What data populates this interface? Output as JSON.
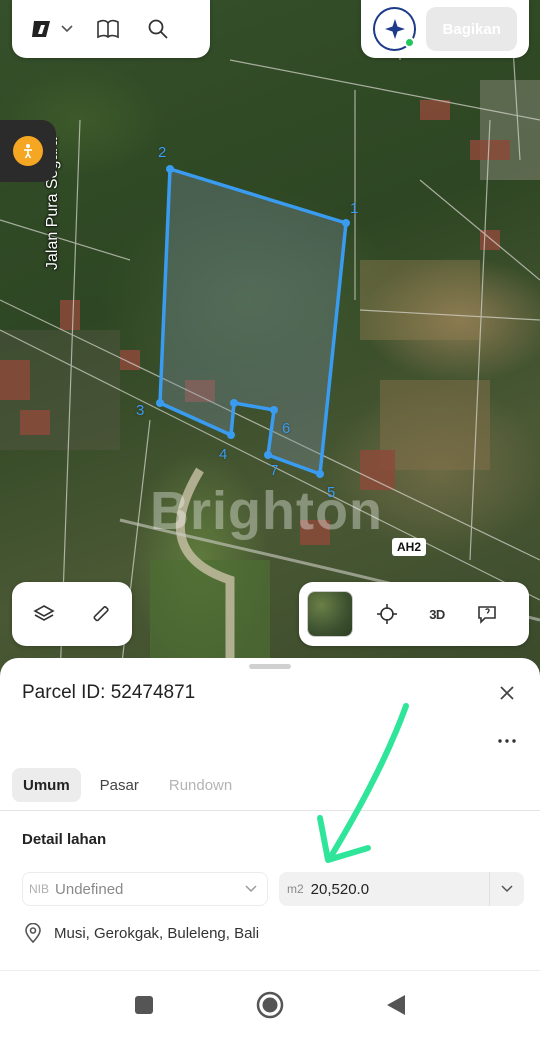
{
  "map": {
    "street_name": "Jalan Pura Segara",
    "watermark": "Brighton",
    "road_badge": "AH2",
    "parcel_point_labels": [
      "1",
      "2",
      "3",
      "4",
      "5",
      "6",
      "7"
    ]
  },
  "toolbar": {
    "share_label": "Bagikan"
  },
  "map_controls": {
    "view_3d_label": "3D"
  },
  "sheet": {
    "parcel_label": "Parcel ID: 52474871",
    "tabs": [
      {
        "label": "Umum",
        "state": "active"
      },
      {
        "label": "Pasar",
        "state": "normal"
      },
      {
        "label": "Rundown",
        "state": "disabled"
      }
    ],
    "section_title": "Detail lahan",
    "nib": {
      "prefix": "NIB",
      "value": "Undefined"
    },
    "area": {
      "prefix": "m2",
      "value": "20,520.0"
    },
    "location": "Musi, Gerokgak, Buleleng, Bali"
  },
  "colors": {
    "parcel_outline": "#3a9cf0",
    "annotation_arrow": "#2ee59a",
    "active_tab_bg": "#ececed",
    "status_online": "#22c55e"
  },
  "icons": [
    "brand-logo-icon",
    "chevron-down-icon",
    "book-map-icon",
    "search-icon",
    "ai-sparkle-icon",
    "street-view-person-icon",
    "layers-icon",
    "measure-ruler-icon",
    "crosshair-locate-icon",
    "chat-feedback-icon",
    "close-icon",
    "more-dots-icon",
    "location-pin-icon",
    "nav-recents-icon",
    "nav-home-icon",
    "nav-back-icon"
  ]
}
